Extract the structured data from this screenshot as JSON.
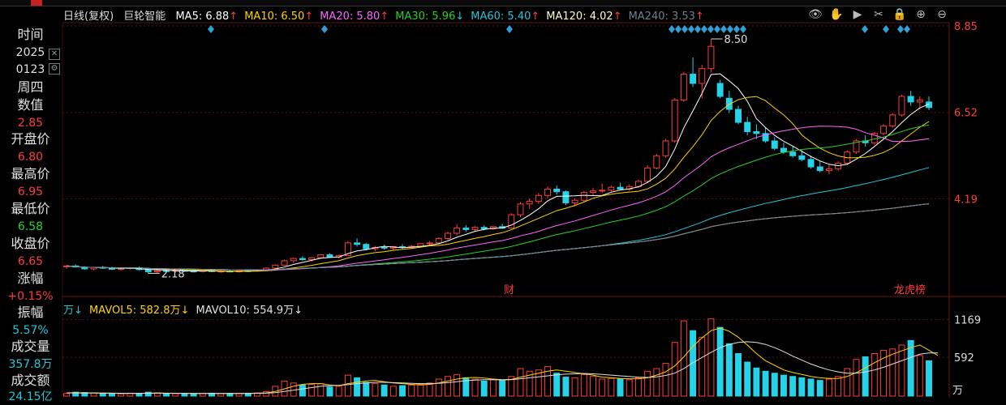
{
  "info_bar": {
    "period": "日线(复权)",
    "stock": "巨轮智能",
    "ma": [
      {
        "label": "MA5: 6.88",
        "arrow": "↑",
        "color": "#ffffff",
        "arrow_color": "#ff3b3b"
      },
      {
        "label": "MA10: 6.50",
        "arrow": "↑",
        "color": "#ffd400",
        "arrow_color": "#ff3b3b"
      },
      {
        "label": "MA20: 5.80",
        "arrow": "↑",
        "color": "#ff66ff",
        "arrow_color": "#ff3b3b"
      },
      {
        "label": "MA30: 5.96",
        "arrow": "↓",
        "color": "#28d028",
        "arrow_color": "#26c6da"
      },
      {
        "label": "MA60: 5.40",
        "arrow": "↑",
        "color": "#26c6da",
        "arrow_color": "#ff3b3b"
      },
      {
        "label": "MA120: 4.02",
        "arrow": "↑",
        "color": "#ffffc8",
        "arrow_color": "#ff3b3b"
      },
      {
        "label": "MA240: 3.53",
        "arrow": "↑",
        "color": "#708090",
        "arrow_color": "#ff3b3b"
      }
    ]
  },
  "toolbar_icons": [
    "eye-icon",
    "hand-icon",
    "play-icon",
    "scissors-icon",
    "lock-icon",
    "plus-circle-icon",
    "minus-circle-icon"
  ],
  "sidebar": {
    "time_label": "时间",
    "year": "2025",
    "date": "0123",
    "weekday": "周四",
    "value_label": "数值",
    "value": "2.85",
    "open_label": "开盘价",
    "open": "6.80",
    "high_label": "最高价",
    "high": "6.95",
    "low_label": "最低价",
    "low": "6.58",
    "close_label": "收盘价",
    "close": "6.65",
    "change_label": "涨幅",
    "change": "+0.15%",
    "amplitude_label": "振幅",
    "amplitude": "5.57%",
    "volume_label": "成交量",
    "volume": "357.8万",
    "amount_label": "成交额",
    "amount": "24.15亿"
  },
  "volume_bar": {
    "prefix": "万↓",
    "mavol5": "MAVOL5: 582.8万↓",
    "mavol10": "MAVOL10: 554.9万↓"
  },
  "annotations": {
    "high": "8.50",
    "low": "2.18",
    "marker_cai": "财",
    "marker_bang": "龙虎榜"
  },
  "chart_data": [
    {
      "type": "candlestick",
      "y_axis_ticks": [
        8.85,
        6.52,
        4.19
      ],
      "ylim": [
        1.6,
        8.85
      ],
      "annotations": {
        "max": 8.5,
        "min": 2.18
      },
      "series_candles": [
        [
          2.36,
          2.4,
          2.3,
          2.38
        ],
        [
          2.38,
          2.42,
          2.34,
          2.35
        ],
        [
          2.35,
          2.37,
          2.28,
          2.3
        ],
        [
          2.3,
          2.36,
          2.26,
          2.34
        ],
        [
          2.34,
          2.38,
          2.3,
          2.32
        ],
        [
          2.32,
          2.36,
          2.27,
          2.29
        ],
        [
          2.29,
          2.33,
          2.25,
          2.31
        ],
        [
          2.31,
          2.35,
          2.28,
          2.33
        ],
        [
          2.33,
          2.36,
          2.26,
          2.28
        ],
        [
          2.28,
          2.31,
          2.18,
          2.22
        ],
        [
          2.22,
          2.27,
          2.19,
          2.25
        ],
        [
          2.25,
          2.29,
          2.21,
          2.24
        ],
        [
          2.24,
          2.28,
          2.2,
          2.26
        ],
        [
          2.26,
          2.3,
          2.22,
          2.24
        ],
        [
          2.24,
          2.27,
          2.2,
          2.23
        ],
        [
          2.23,
          2.27,
          2.2,
          2.25
        ],
        [
          2.25,
          2.28,
          2.21,
          2.23
        ],
        [
          2.23,
          2.26,
          2.19,
          2.24
        ],
        [
          2.24,
          2.27,
          2.21,
          2.22
        ],
        [
          2.22,
          2.26,
          2.2,
          2.25
        ],
        [
          2.25,
          2.28,
          2.21,
          2.24
        ],
        [
          2.24,
          2.29,
          2.22,
          2.27
        ],
        [
          2.27,
          2.34,
          2.25,
          2.32
        ],
        [
          2.32,
          2.42,
          2.3,
          2.4
        ],
        [
          2.4,
          2.55,
          2.38,
          2.52
        ],
        [
          2.52,
          2.6,
          2.46,
          2.58
        ],
        [
          2.58,
          2.64,
          2.52,
          2.55
        ],
        [
          2.55,
          2.62,
          2.5,
          2.6
        ],
        [
          2.6,
          2.7,
          2.57,
          2.68
        ],
        [
          2.68,
          2.72,
          2.6,
          2.62
        ],
        [
          2.62,
          2.68,
          2.58,
          2.66
        ],
        [
          2.66,
          3.05,
          2.64,
          3.0
        ],
        [
          3.0,
          3.12,
          2.9,
          2.96
        ],
        [
          2.96,
          3.0,
          2.8,
          2.84
        ],
        [
          2.84,
          2.92,
          2.78,
          2.88
        ],
        [
          2.88,
          2.95,
          2.82,
          2.86
        ],
        [
          2.86,
          2.92,
          2.8,
          2.9
        ],
        [
          2.9,
          2.96,
          2.84,
          2.88
        ],
        [
          2.88,
          2.94,
          2.84,
          2.91
        ],
        [
          2.91,
          3.0,
          2.88,
          2.98
        ],
        [
          2.98,
          3.05,
          2.93,
          3.0
        ],
        [
          3.0,
          3.15,
          2.96,
          3.12
        ],
        [
          3.12,
          3.3,
          3.08,
          3.26
        ],
        [
          3.26,
          3.5,
          3.2,
          3.4
        ],
        [
          3.4,
          3.48,
          3.3,
          3.36
        ],
        [
          3.36,
          3.45,
          3.32,
          3.42
        ],
        [
          3.42,
          3.48,
          3.34,
          3.38
        ],
        [
          3.38,
          3.46,
          3.35,
          3.44
        ],
        [
          3.44,
          3.52,
          3.38,
          3.4
        ],
        [
          3.4,
          3.8,
          3.38,
          3.76
        ],
        [
          3.76,
          4.1,
          3.7,
          4.05
        ],
        [
          4.05,
          4.2,
          3.92,
          4.12
        ],
        [
          4.12,
          4.35,
          4.05,
          4.28
        ],
        [
          4.28,
          4.52,
          4.2,
          4.45
        ],
        [
          4.45,
          4.55,
          4.3,
          4.38
        ],
        [
          4.38,
          4.42,
          4.02,
          4.08
        ],
        [
          4.08,
          4.2,
          3.98,
          4.15
        ],
        [
          4.15,
          4.4,
          4.1,
          4.36
        ],
        [
          4.36,
          4.48,
          4.28,
          4.4
        ],
        [
          4.4,
          4.6,
          4.35,
          4.42
        ],
        [
          4.42,
          4.55,
          4.38,
          4.5
        ],
        [
          4.5,
          4.62,
          4.42,
          4.45
        ],
        [
          4.45,
          4.58,
          4.4,
          4.52
        ],
        [
          4.52,
          4.7,
          4.48,
          4.66
        ],
        [
          4.66,
          5.1,
          4.62,
          5.02
        ],
        [
          5.02,
          5.4,
          4.98,
          5.35
        ],
        [
          5.35,
          5.8,
          5.3,
          5.75
        ],
        [
          5.75,
          6.9,
          5.7,
          6.85
        ],
        [
          6.85,
          7.6,
          6.8,
          7.55
        ],
        [
          7.55,
          8.0,
          7.2,
          7.3
        ],
        [
          7.3,
          7.8,
          6.9,
          7.7
        ],
        [
          7.7,
          8.5,
          7.6,
          8.3
        ],
        [
          7.3,
          7.4,
          6.9,
          6.95
        ],
        [
          6.9,
          7.1,
          6.5,
          6.6
        ],
        [
          6.6,
          6.7,
          6.2,
          6.25
        ],
        [
          6.25,
          6.4,
          5.9,
          6.0
        ],
        [
          6.0,
          6.2,
          5.8,
          5.95
        ],
        [
          5.95,
          6.1,
          5.7,
          5.75
        ],
        [
          5.75,
          5.85,
          5.5,
          5.55
        ],
        [
          5.55,
          5.7,
          5.4,
          5.45
        ],
        [
          5.45,
          5.6,
          5.3,
          5.35
        ],
        [
          5.35,
          5.5,
          5.2,
          5.25
        ],
        [
          5.25,
          5.35,
          5.0,
          5.05
        ],
        [
          5.05,
          5.2,
          4.9,
          4.95
        ],
        [
          4.95,
          5.1,
          4.85,
          5.0
        ],
        [
          5.0,
          5.2,
          4.95,
          5.15
        ],
        [
          5.15,
          5.5,
          5.1,
          5.45
        ],
        [
          5.45,
          5.8,
          5.4,
          5.75
        ],
        [
          5.75,
          5.9,
          5.6,
          5.7
        ],
        [
          5.7,
          6.0,
          5.65,
          5.95
        ],
        [
          5.95,
          6.2,
          5.9,
          6.15
        ],
        [
          6.15,
          6.5,
          6.1,
          6.45
        ],
        [
          6.45,
          7.0,
          6.4,
          6.95
        ],
        [
          6.95,
          7.1,
          6.7,
          6.8
        ],
        [
          6.8,
          6.95,
          6.6,
          6.85
        ],
        [
          6.8,
          6.95,
          6.58,
          6.65
        ]
      ]
    },
    {
      "type": "bar",
      "y_axis_ticks": [
        1169,
        592
      ],
      "y_unit": "万",
      "ylim": [
        0,
        1250
      ],
      "values": [
        40,
        60,
        55,
        50,
        45,
        40,
        35,
        45,
        40,
        60,
        50,
        40,
        38,
        42,
        36,
        40,
        45,
        38,
        42,
        40,
        44,
        48,
        70,
        150,
        230,
        200,
        170,
        180,
        190,
        140,
        150,
        320,
        280,
        210,
        190,
        170,
        150,
        160,
        170,
        180,
        200,
        260,
        300,
        330,
        280,
        260,
        230,
        250,
        240,
        300,
        420,
        380,
        400,
        450,
        350,
        290,
        280,
        330,
        300,
        260,
        270,
        260,
        250,
        280,
        380,
        420,
        500,
        820,
        1150,
        1000,
        900,
        1180,
        1050,
        800,
        650,
        520,
        430,
        380,
        350,
        320,
        300,
        280,
        260,
        240,
        260,
        300,
        420,
        560,
        600,
        650,
        700,
        720,
        780,
        850,
        620,
        540,
        480
      ],
      "ma5_values": [
        50,
        52,
        50,
        48,
        46,
        44,
        42,
        40,
        42,
        44,
        46,
        44,
        43,
        42,
        40,
        40,
        40,
        40,
        40,
        40,
        42,
        44,
        50,
        70,
        110,
        150,
        180,
        190,
        190,
        170,
        160,
        190,
        210,
        230,
        240,
        220,
        200,
        190,
        180,
        170,
        180,
        200,
        230,
        260,
        280,
        285,
        275,
        260,
        250,
        255,
        290,
        320,
        350,
        380,
        400,
        380,
        360,
        340,
        320,
        290,
        280,
        270,
        265,
        262,
        280,
        320,
        370,
        460,
        600,
        760,
        890,
        1000,
        1040,
        990,
        900,
        780,
        650,
        540,
        470,
        400,
        360,
        330,
        300,
        280,
        270,
        270,
        300,
        360,
        430,
        510,
        580,
        640,
        690,
        740,
        780,
        700,
        620
      ],
      "ma10_values": [
        48,
        48,
        47,
        46,
        45,
        44,
        43,
        42,
        42,
        43,
        44,
        43,
        42,
        42,
        41,
        41,
        41,
        41,
        40,
        40,
        41,
        42,
        44,
        52,
        70,
        90,
        110,
        130,
        150,
        160,
        165,
        175,
        190,
        200,
        210,
        210,
        205,
        200,
        195,
        190,
        190,
        195,
        205,
        220,
        235,
        245,
        250,
        250,
        248,
        250,
        265,
        280,
        295,
        310,
        325,
        335,
        340,
        345,
        340,
        330,
        320,
        310,
        300,
        290,
        285,
        295,
        315,
        350,
        420,
        510,
        590,
        670,
        740,
        790,
        820,
        830,
        820,
        790,
        740,
        680,
        610,
        550,
        490,
        440,
        400,
        370,
        350,
        350,
        370,
        400,
        440,
        490,
        540,
        590,
        640,
        660,
        660
      ]
    }
  ]
}
